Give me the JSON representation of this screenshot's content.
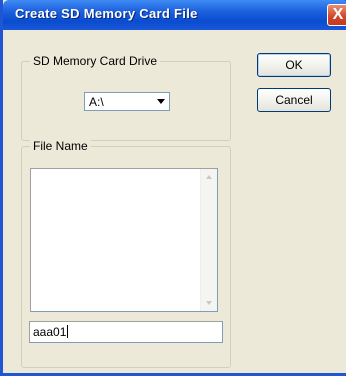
{
  "window": {
    "title": "Create SD Memory Card File",
    "close_glyph": "X"
  },
  "drive_group": {
    "label": "SD Memory Card Drive",
    "selected_drive": "A:\\"
  },
  "file_group": {
    "label": "File Name",
    "file_name_value": "aaa01"
  },
  "buttons": {
    "ok": "OK",
    "cancel": "Cancel"
  },
  "colors": {
    "title_bar": "#0a4ccf",
    "close_button": "#d0462a",
    "dialog_background": "#ece9d8"
  }
}
